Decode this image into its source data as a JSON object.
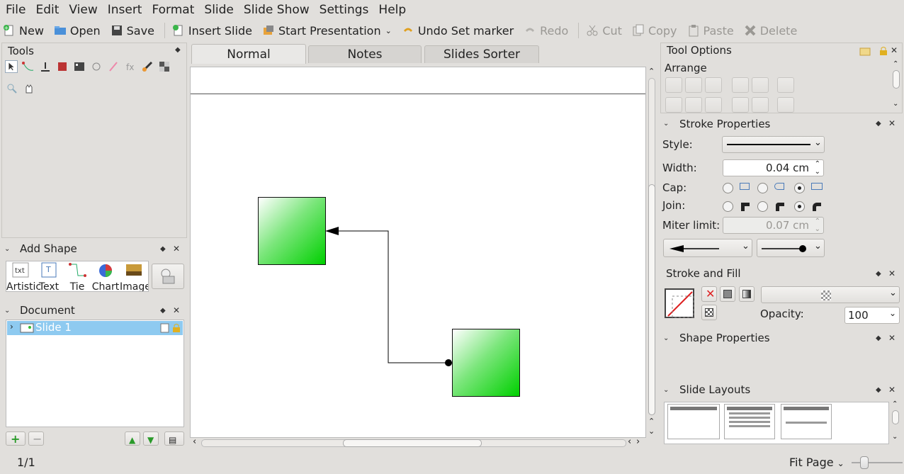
{
  "menu": [
    "File",
    "Edit",
    "View",
    "Insert",
    "Format",
    "Slide",
    "Slide Show",
    "Settings",
    "Help"
  ],
  "toolbar": {
    "new": "New",
    "open": "Open",
    "save": "Save",
    "insert_slide": "Insert Slide",
    "start_presentation": "Start Presentation",
    "undo": "Undo Set marker",
    "redo": "Redo",
    "cut": "Cut",
    "copy": "Copy",
    "paste": "Paste",
    "delete": "Delete"
  },
  "tools": {
    "title": "Tools"
  },
  "add_shape": {
    "title": "Add Shape",
    "items": [
      "Artistic",
      "Text",
      "Tie",
      "Chart",
      "Image"
    ]
  },
  "document": {
    "title": "Document",
    "slide": "Slide 1"
  },
  "tabs": [
    "Normal",
    "Notes",
    "Slides Sorter"
  ],
  "tool_options": {
    "title": "Tool Options",
    "arrange": "Arrange"
  },
  "stroke": {
    "title": "Stroke Properties",
    "style_label": "Style:",
    "width_label": "Width:",
    "width_value": "0.04 cm",
    "cap_label": "Cap:",
    "join_label": "Join:",
    "miter_label": "Miter limit:",
    "miter_value": "0.07 cm"
  },
  "stroke_fill": {
    "title": "Stroke and Fill",
    "opacity_label": "Opacity:",
    "opacity_value": "100"
  },
  "shape_props": {
    "title": "Shape Properties"
  },
  "slide_layouts": {
    "title": "Slide Layouts"
  },
  "status": {
    "page": "1/1",
    "zoom": "Fit Page"
  },
  "colors": {
    "shape_fill": "#00d000",
    "selection": "#8ecaf0"
  }
}
